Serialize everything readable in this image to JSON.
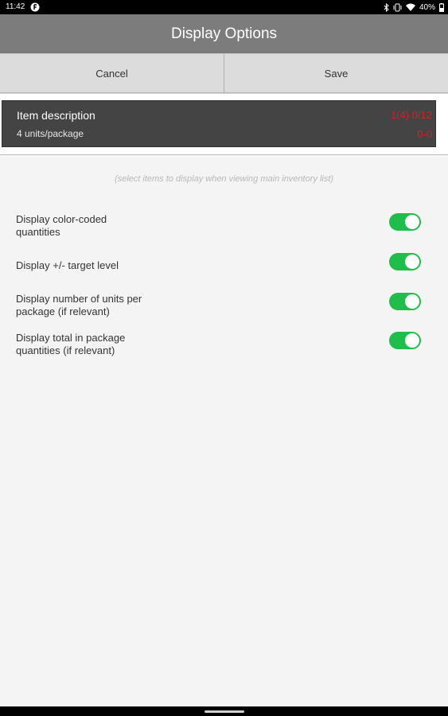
{
  "status_bar": {
    "time": "11:42",
    "app_icon": "f-app-icon",
    "battery_percent": "40%"
  },
  "app_bar": {
    "title": "Display Options"
  },
  "actions": {
    "cancel_label": "Cancel",
    "save_label": "Save"
  },
  "preview": {
    "title": "Item description",
    "subtitle": "4 units/package",
    "qty_primary": "1(4) 0/12",
    "qty_secondary": "0-0"
  },
  "hint": "(select items to display when viewing main inventory list)",
  "options": [
    {
      "label_line1": "Display color-coded",
      "label_line2": "quantities",
      "enabled": true
    },
    {
      "label_line1": "Display +/- target level",
      "label_line2": "",
      "enabled": true
    },
    {
      "label_line1": "Display number of units per",
      "label_line2": "package (if relevant)",
      "enabled": true
    },
    {
      "label_line1": "Display total in package",
      "label_line2": "quantities (if relevant)",
      "enabled": true
    }
  ],
  "colors": {
    "app_bar": "#7c7c7c",
    "toggle_on": "#1fbd4a",
    "quantity_red": "#d32020",
    "preview_bg": "#444444"
  }
}
